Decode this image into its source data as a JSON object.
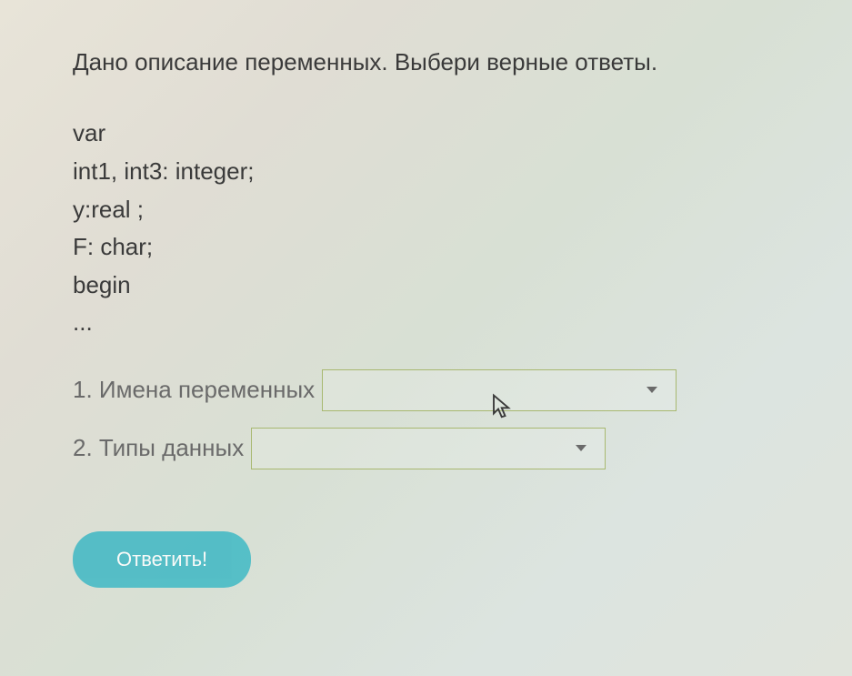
{
  "question": {
    "prompt": "Дано описание переменных. Выбери верные ответы.",
    "code": {
      "line1": "var",
      "line2": "int1, int3: integer;",
      "line3": "y:real ;",
      "line4": "F: char;",
      "line5": "begin",
      "line6": "..."
    }
  },
  "dropdowns": {
    "item1": {
      "label": "1. Имена переменных",
      "value": ""
    },
    "item2": {
      "label": "2. Типы данных",
      "value": ""
    }
  },
  "submit": {
    "label": "Ответить!"
  }
}
